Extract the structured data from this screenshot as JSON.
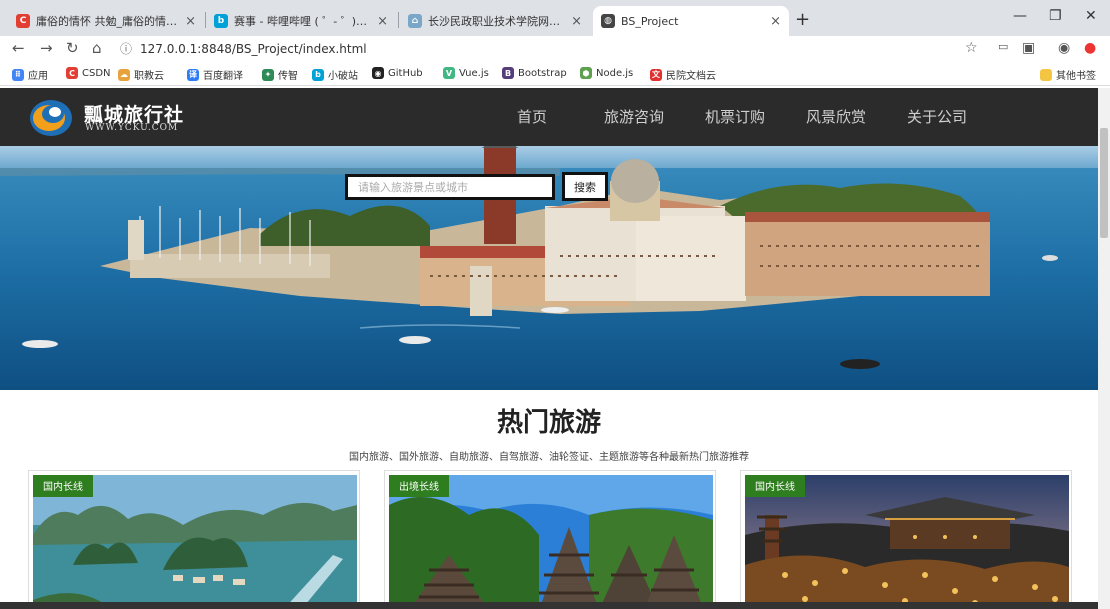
{
  "browser": {
    "tabs": [
      {
        "title": "庸俗的情怀 共勉_庸俗的情怀_CS",
        "icon": "csdn-icon",
        "color": "#e33e33",
        "glyph": "C"
      },
      {
        "title": "赛事 - 哔哩哔哩 ( ゜- ゜)つロ 干杯",
        "icon": "bilibili-icon",
        "color": "#00a1d6",
        "glyph": "b"
      },
      {
        "title": "长沙民政职业技术学院网上办事",
        "icon": "school-icon",
        "color": "#7aa7c7",
        "glyph": "⌂"
      },
      {
        "title": "BS_Project",
        "icon": "globe-icon",
        "color": "#444444",
        "glyph": "◍"
      }
    ],
    "url_info": "ⓘ",
    "url": "127.0.0.1:8848/BS_Project/index.html",
    "bookmarks": [
      {
        "label": "应用",
        "icon": "apps-icon",
        "color": "#4285f4",
        "glyph": "⠿"
      },
      {
        "label": "CSDN",
        "icon": "csdn-icon",
        "color": "#e33e33",
        "glyph": "C"
      },
      {
        "label": "职教云",
        "icon": "cloud-icon",
        "color": "#e8a23b",
        "glyph": "☁"
      },
      {
        "label": "百度翻译",
        "icon": "translate-icon",
        "color": "#2f7df6",
        "glyph": "译"
      },
      {
        "label": "传智",
        "icon": "chuanzhi-icon",
        "color": "#2e8b57",
        "glyph": "✦"
      },
      {
        "label": "小破站",
        "icon": "bilibili-icon",
        "color": "#00a1d6",
        "glyph": "b"
      },
      {
        "label": "GitHub",
        "icon": "github-icon",
        "color": "#222222",
        "glyph": "◉"
      },
      {
        "label": "Vue.js",
        "icon": "vue-icon",
        "color": "#41b883",
        "glyph": "V"
      },
      {
        "label": "Bootstrap",
        "icon": "bootstrap-icon",
        "color": "#563d7c",
        "glyph": "B"
      },
      {
        "label": "Node.js",
        "icon": "nodejs-icon",
        "color": "#5fa04e",
        "glyph": "⬢"
      },
      {
        "label": "民院文档云",
        "icon": "doc-cloud-icon",
        "color": "#e03030",
        "glyph": "文"
      }
    ],
    "other_bookmarks": "其他书签"
  },
  "site": {
    "logo_text": "瓢城旅行社",
    "logo_sub": "WWW.YCKU.COM",
    "menu": [
      "首页",
      "旅游咨询",
      "机票订购",
      "风景欣赏",
      "关于公司"
    ]
  },
  "search": {
    "placeholder": "请输入旅游景点或城市",
    "button": "搜索"
  },
  "section": {
    "title": "热门旅游",
    "subtitle": "国内旅游、国外旅游、自助旅游、自驾旅游、油轮签证、主题旅游等各种最新热门旅游推荐"
  },
  "cards": [
    {
      "badge": "国内长线"
    },
    {
      "badge": "出境长线"
    },
    {
      "badge": "国内长线"
    }
  ],
  "colors": {
    "nav_bg": "#2b2b2b",
    "badge": "#2e7d1f"
  }
}
